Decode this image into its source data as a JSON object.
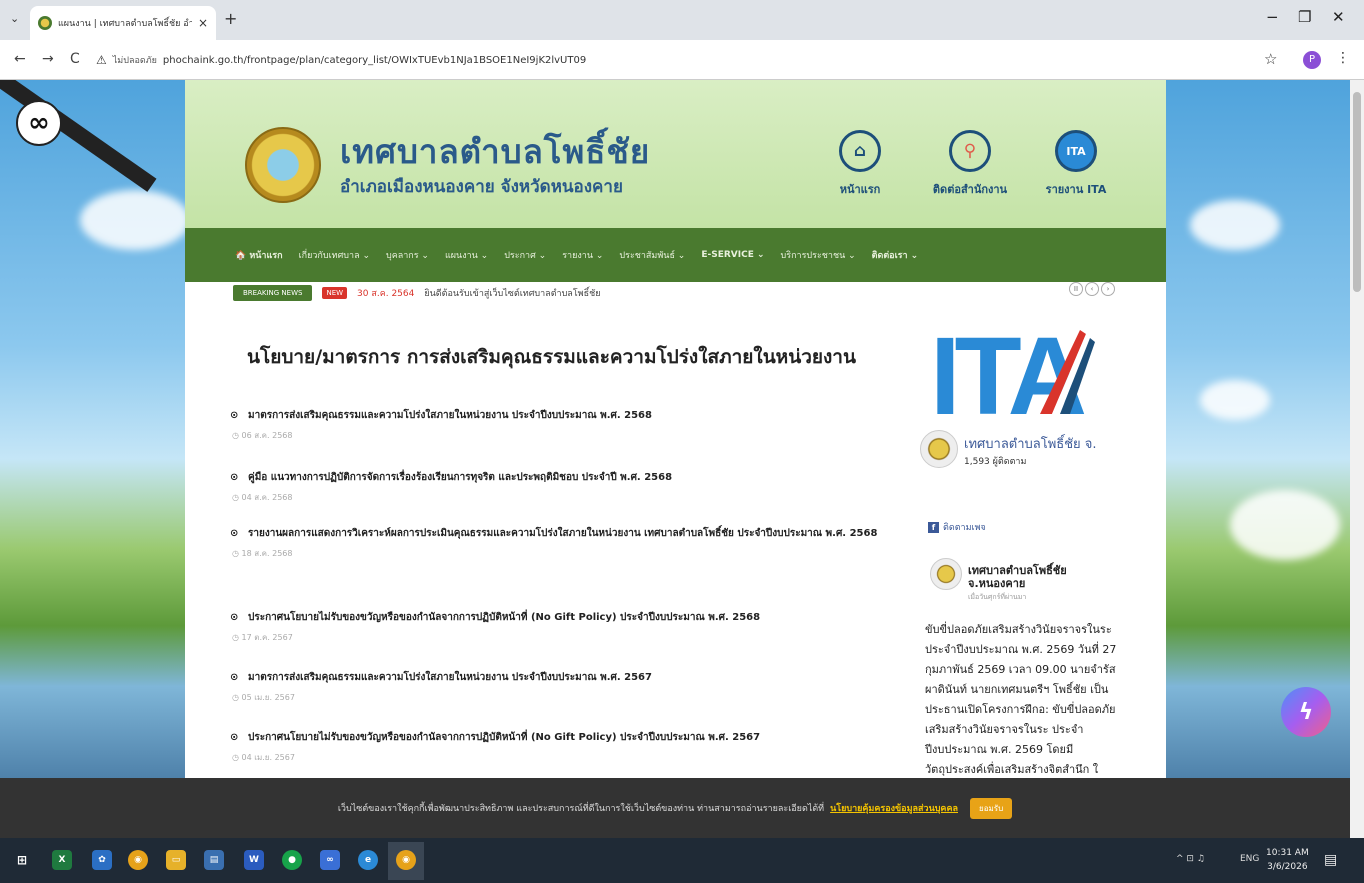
{
  "browser": {
    "tab_title": "แผนงาน | เทศบาลตำบลโพธิ์ชัย อำเ",
    "tab_close": "×",
    "new_tab": "+",
    "insecure_label": "ไม่ปลอดภัย",
    "url": "phochaink.go.th/frontpage/plan/category_list/OWIxTUEvb1NJa1BSOE1NeI9jK2lvUT09",
    "profile_initial": "P",
    "window_controls": {
      "minimize": "−",
      "maximize": "❐",
      "close": "✕"
    },
    "nav": {
      "back": "←",
      "forward": "→",
      "reload": "C"
    }
  },
  "site": {
    "title": "เทศบาลตำบลโพธิ์ชัย",
    "subtitle": "อำเภอเมืองหนองคาย จังหวัดหนองคาย",
    "header_links": [
      {
        "label": "หน้าแรก",
        "icon": "home-icon",
        "glyph": "⌂"
      },
      {
        "label": "ติดต่อสำนักงาน",
        "icon": "location-pin-icon",
        "glyph": "⚲"
      },
      {
        "label": "รายงาน ITA",
        "icon": "ita-icon",
        "glyph": "ITA"
      }
    ],
    "nav_items": [
      "🏠 หน้าแรก",
      "เกี่ยวกับเทศบาล ⌄",
      "บุคลากร ⌄",
      "แผนงาน ⌄",
      "ประกาศ ⌄",
      "รายงาน ⌄",
      "ประชาสัมพันธ์ ⌄",
      "E-SERVICE ⌄",
      "บริการประชาชน ⌄",
      "ติดต่อเรา ⌄"
    ],
    "breaking": {
      "label": "BREAKING NEWS",
      "new_badge": "NEW",
      "date": "30 ส.ค. 2564",
      "text": "ยินดีต้อนรับเข้าสู่เว็บไซต์เทศบาลตำบลโพธิ์ชัย",
      "controls": [
        "II",
        "‹",
        "›"
      ]
    }
  },
  "main": {
    "heading": "นโยบาย/มาตรการ การส่งเสริมคุณธรรมและความโปร่งใสภายในหน่วยงาน",
    "posts": [
      {
        "title": "มาตรการส่งเสริมคุณธรรมและความโปร่งใสภายในหน่วยงาน ประจำปีงบประมาณ พ.ศ. 2568",
        "date": "06 ส.ค. 2568"
      },
      {
        "title": "คู่มือ แนวทางการปฏิบัติการจัดการเรื่องร้องเรียนการทุจริต และประพฤติมิชอบ ประจำปี พ.ศ. 2568",
        "date": "04 ส.ค. 2568"
      },
      {
        "title": "รายงานผลการแสดงการวิเคราะห์ผลการประเมินคุณธรรมและความโปร่งใสภายในหน่วยงาน เทศบาลตำบลโพธิ์ชัย ประจำปีงบประมาณ พ.ศ. 2568",
        "date": "18 ส.ค. 2568"
      },
      {
        "title": "ประกาศนโยบายไม่รับของขวัญหรือของกำนัลจากการปฏิบัติหน้าที่ (No Gift Policy) ประจำปีงบประมาณ พ.ศ. 2568",
        "date": "17 ต.ค. 2567"
      },
      {
        "title": "มาตรการส่งเสริมคุณธรรมและความโปร่งใสภายในหน่วยงาน ประจำปีงบประมาณ พ.ศ. 2567",
        "date": "05 เม.ย. 2567"
      },
      {
        "title": "ประกาศนโยบายไม่รับของขวัญหรือของกำนัลจากการปฏิบัติหน้าที่ (No Gift Policy) ประจำปีงบประมาณ พ.ศ. 2567",
        "date": "04 เม.ย. 2567"
      }
    ]
  },
  "sidebar": {
    "ita_text": "ITA",
    "fb_page_name": "เทศบาลตำบลโพธิ์ชัย จ.",
    "fb_followers": "1,593 ผู้ติดตาม",
    "follow_label": "ติดตามเพจ",
    "feed": {
      "name": "เทศบาลตำบลโพธิ์ชัย จ.หนองคาย",
      "meta": "เมื่อวันศุกร์ที่ผ่านมา",
      "body": "ขับขี่ปลอดภัยเสริมสร้างวินัยจราจรในระ ประจำปีงบประมาณ พ.ศ. 2569 วันที่ 27 กุมภาพันธ์ 2569 เวลา 09.00 นายจำรัส ผาดินันท์ นายกเทศมนตรีฯ โพธิ์ชัย เป็นประธานเปิดโครงการฝึกอ: ขับขี่ปลอดภัยเสริมสร้างวินัยจราจรในระ ประจำปีงบประมาณ พ.ศ. 2569 โดยมี วัตถุประสงค์เพื่อเสริมสร้างจิตสำนึก ใ"
    }
  },
  "cookie": {
    "text": "เว็บไซต์ของเราใช้คุกกี้เพื่อพัฒนาประสิทธิภาพ และประสบการณ์ที่ดีในการใช้เว็บไซต์ของท่าน ท่านสามารถอ่านรายละเอียดได้ที่",
    "link": "นโยบายคุ้มครองข้อมูลส่วนบุคคล",
    "accept": "ยอมรับ"
  },
  "taskbar": {
    "language": "ENG",
    "time": "10:31 AM",
    "date": "3/6/2026"
  },
  "colors": {
    "nav_green": "#4a7a2f",
    "header_green": "#c4e3a6",
    "title_blue": "#2a5a8a",
    "accent_red": "#d9342b",
    "cookie_btn": "#e8a317"
  }
}
